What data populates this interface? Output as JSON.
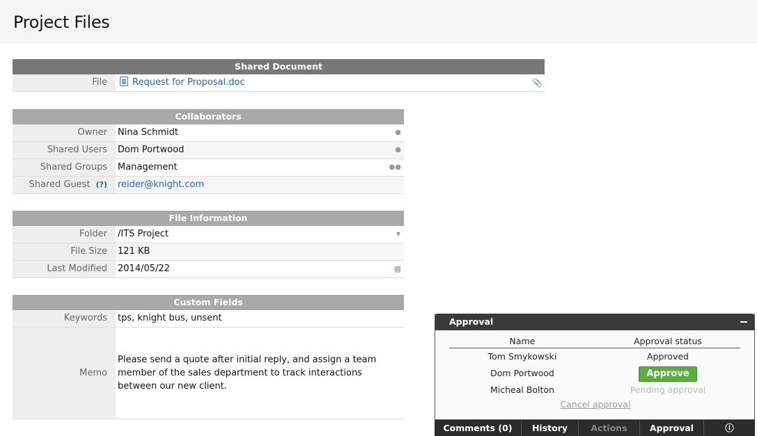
{
  "page": {
    "title": "Project Files"
  },
  "shared_document": {
    "header": "Shared Document",
    "file_label": "File",
    "file_name": "Request for Proposal.doc",
    "file_icon": "word-doc-icon",
    "attach_icon": "paperclip-icon"
  },
  "collaborators": {
    "header": "Collaborators",
    "rows": [
      {
        "label": "Owner",
        "value": "Nina Schmidt",
        "icon": "user-icon"
      },
      {
        "label": "Shared Users",
        "value": "Dom Portwood",
        "icon": "user-icon"
      },
      {
        "label": "Shared Groups",
        "value": "Management",
        "icon": "group-icon"
      },
      {
        "label": "Shared Guest",
        "help": "(?)",
        "value": "reider@knight.com"
      }
    ]
  },
  "file_info": {
    "header": "File Information",
    "rows": [
      {
        "label": "Folder",
        "value": "/ITS Project",
        "icon": "caret-down-icon"
      },
      {
        "label": "File Size",
        "value": "121 KB"
      },
      {
        "label": "Last Modified",
        "value": "2014/05/22",
        "icon": "calendar-icon"
      }
    ]
  },
  "custom_fields": {
    "header": "Custom Fields",
    "keywords_label": "Keywords",
    "keywords": "tps, knight bus, unsent",
    "memo_label": "Memo",
    "memo": "Please send a quote after initial reply, and assign a team member of the sales department to track interactions between our new client."
  },
  "approval": {
    "title": "Approval",
    "col_name": "Name",
    "col_status": "Approval status",
    "rows": [
      {
        "name": "Tom Smykowski",
        "status": "Approved"
      },
      {
        "name": "Dom Portwood",
        "status": "Approve"
      },
      {
        "name": "Micheal Bolton",
        "status": "Pending approval"
      }
    ],
    "cancel": "Cancel approval",
    "colors": {
      "header": "#3a3a3a",
      "approve": "#5cae3c"
    }
  },
  "tabs": [
    {
      "label": "Comments (0)"
    },
    {
      "label": "History"
    },
    {
      "label": "Actions"
    },
    {
      "label": "Approval"
    },
    {
      "icon": "info-icon"
    }
  ]
}
